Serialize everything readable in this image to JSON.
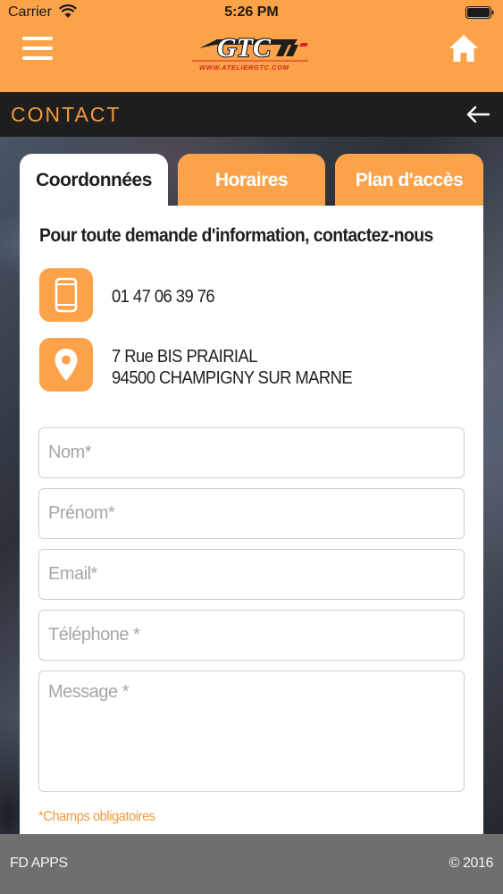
{
  "status_bar": {
    "carrier": "Carrier",
    "time": "5:26 PM"
  },
  "header": {
    "logo_text": "GTC",
    "logo_tagline": "WWW.ATELIERGTC.COM",
    "menu_icon": "hamburger-menu-icon",
    "home_icon": "home-icon",
    "background_color": "#fca34a"
  },
  "page": {
    "title": "CONTACT",
    "back_icon": "arrow-left-icon"
  },
  "tabs": [
    {
      "label": "Coordonnées",
      "active": true
    },
    {
      "label": "Horaires",
      "active": false
    },
    {
      "label": "Plan d'accès",
      "active": false
    }
  ],
  "contact": {
    "intro": "Pour toute demande d'information, contactez-nous",
    "phone": "01 47 06 39 76",
    "address_line1": "7 Rue BIS PRAIRIAL",
    "address_line2": "94500 CHAMPIGNY SUR MARNE",
    "phone_icon": "smartphone-icon",
    "address_icon": "map-pin-icon"
  },
  "form": {
    "nom_placeholder": "Nom*",
    "prenom_placeholder": "Prénom*",
    "email_placeholder": "Email*",
    "telephone_placeholder": "Téléphone *",
    "message_placeholder": "Message *",
    "required_note": "*Champs obligatoires"
  },
  "footer": {
    "left": "FD APPS",
    "right": "© 2016"
  },
  "colors": {
    "accent": "#fca34a",
    "dark_bar": "#1e1e1e",
    "footer": "#6f6f6f"
  }
}
